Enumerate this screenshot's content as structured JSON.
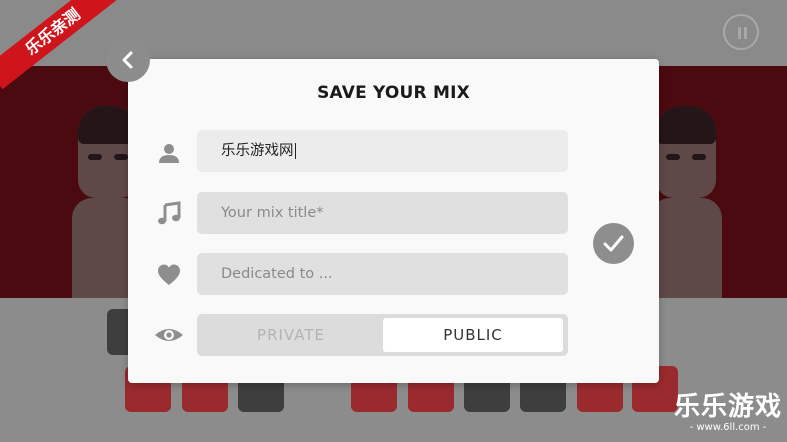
{
  "dialog": {
    "title": "SAVE YOUR MIX",
    "author_value": "乐乐游戏网",
    "mix_title_placeholder": "Your mix title*",
    "dedicated_placeholder": "Dedicated to ...",
    "visibility": {
      "options": [
        "PRIVATE",
        "PUBLIC"
      ],
      "selected": "PUBLIC"
    }
  },
  "icons": {
    "back": "chevron-left-icon",
    "author": "user-icon",
    "mix_title": "music-note-icon",
    "dedicated": "heart-icon",
    "visibility": "eye-icon",
    "confirm": "check-icon",
    "pause": "pause-icon"
  },
  "watermark": {
    "corner_stamp": "乐乐亲测",
    "title": "乐乐游戏",
    "url": "- www.6ll.com -"
  },
  "colors": {
    "stage": "#4a0a10",
    "dialog_bg": "#f9f9f9",
    "field_bg": "#e0e0e0",
    "button_grey": "#8e8e8e",
    "stamp_red": "#d0141c"
  }
}
